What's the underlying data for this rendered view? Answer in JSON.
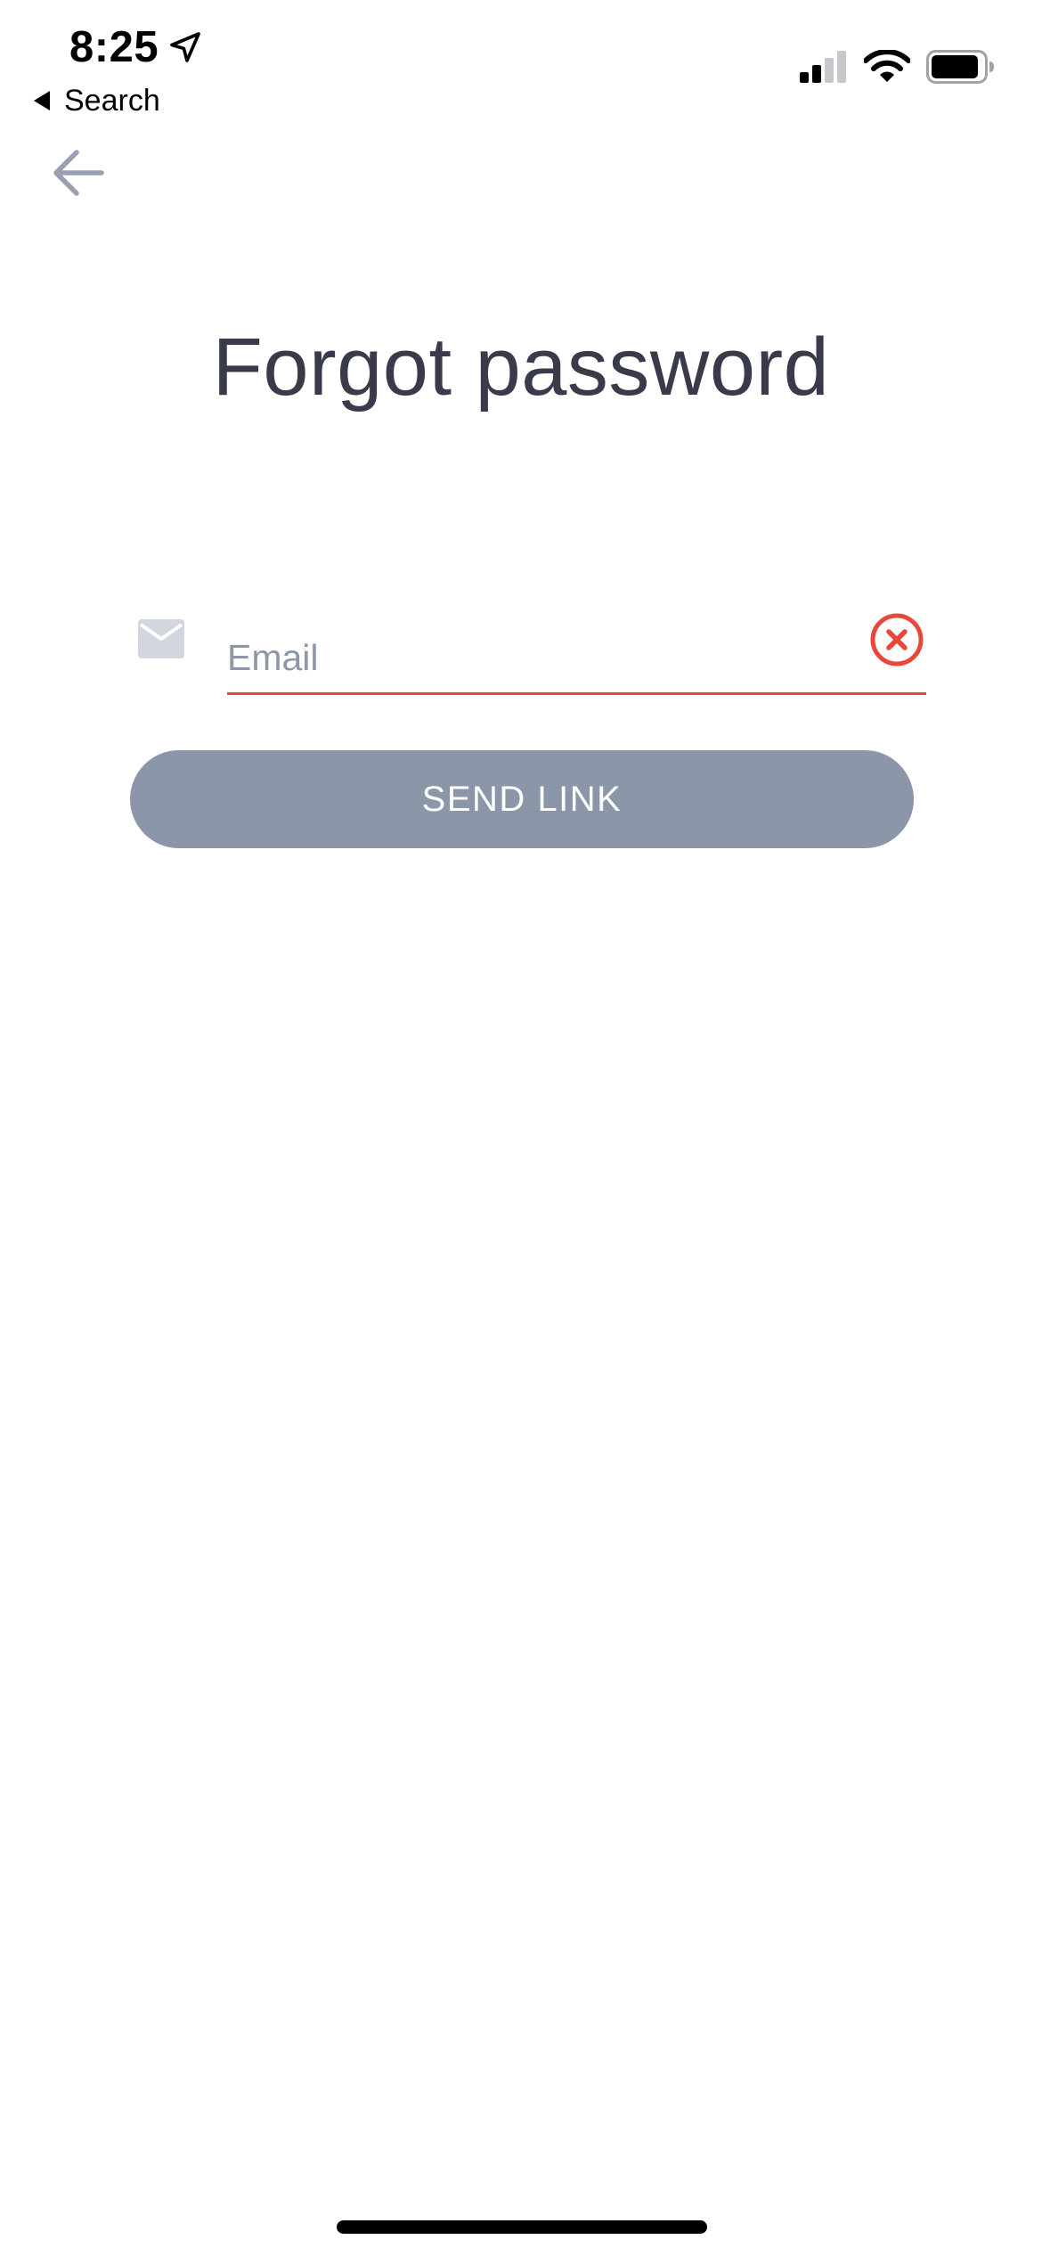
{
  "status_bar": {
    "time": "8:25",
    "back_app_label": "Search",
    "icons": [
      "location-arrow-icon",
      "cellular-signal-icon",
      "wifi-icon",
      "battery-icon"
    ]
  },
  "nav": {
    "back_icon": "arrow-left-icon"
  },
  "page": {
    "title": "Forgot password"
  },
  "form": {
    "email": {
      "icon": "mail-icon",
      "value": "",
      "placeholder": "Email",
      "state": "error",
      "clear_icon": "clear-circle-icon"
    },
    "send_button_label": "SEND LINK"
  },
  "colors": {
    "title": "#393b4b",
    "placeholder": "#8e97a8",
    "error": "#e8483b",
    "button_bg": "#8b96a8",
    "button_text": "#ffffff",
    "back_arrow": "#9a9fb2",
    "mail_icon": "#d2d6de"
  }
}
